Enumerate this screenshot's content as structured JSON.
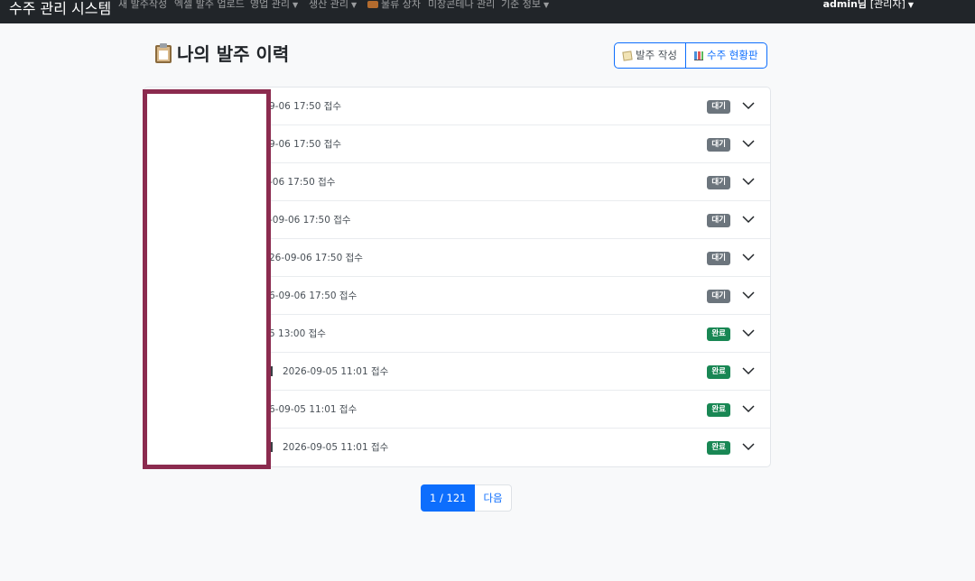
{
  "navbar": {
    "brand": "수주 관리 시스템",
    "items": [
      {
        "label": "새 발주작성",
        "dropdown": false,
        "icon": ""
      },
      {
        "label": "엑셀 발주 업로드",
        "dropdown": false,
        "icon": ""
      },
      {
        "label": "영업 관리",
        "dropdown": true,
        "icon": ""
      },
      {
        "label": "생산 관리",
        "dropdown": true,
        "icon": ""
      },
      {
        "label": "물류 상차",
        "dropdown": false,
        "icon": "truck-icon"
      },
      {
        "label": "미장콘테나 관리",
        "dropdown": false,
        "icon": ""
      },
      {
        "label": "기준 정보",
        "dropdown": true,
        "icon": ""
      }
    ],
    "user": {
      "name": "admin님",
      "role": "[관리자]"
    }
  },
  "header": {
    "title": "나의 발주 이력",
    "buttons": {
      "create": "발주 작성",
      "dashboard": "수주 현황판"
    }
  },
  "orders": [
    {
      "text": "9-06 17:50 접수",
      "status": "대기",
      "has_icon": false
    },
    {
      "text": "9-06 17:50 접수",
      "status": "대기",
      "has_icon": false
    },
    {
      "text": "-06 17:50 접수",
      "status": "대기",
      "has_icon": false
    },
    {
      "text": "-09-06 17:50 접수",
      "status": "대기",
      "has_icon": false
    },
    {
      "text": "26-09-06 17:50 접수",
      "status": "대기",
      "has_icon": false
    },
    {
      "text": "6-09-06 17:50 접수",
      "status": "대기",
      "has_icon": false
    },
    {
      "text": "5 13:00 접수",
      "status": "완료",
      "has_icon": false
    },
    {
      "text": "2026-09-05 11:01 접수",
      "status": "완료",
      "has_icon": true
    },
    {
      "text": "6-09-05 11:01 접수",
      "status": "완료",
      "has_icon": false
    },
    {
      "text": "2026-09-05 11:01 접수",
      "status": "완료",
      "has_icon": true
    }
  ],
  "pagination": {
    "current": "1 / 121",
    "next": "다음"
  },
  "colors": {
    "navbar_bg": "#212529",
    "primary": "#0d6efd",
    "badge_wait": "#6c757d",
    "badge_done": "#198754",
    "redaction_border": "#8b2b4f"
  }
}
